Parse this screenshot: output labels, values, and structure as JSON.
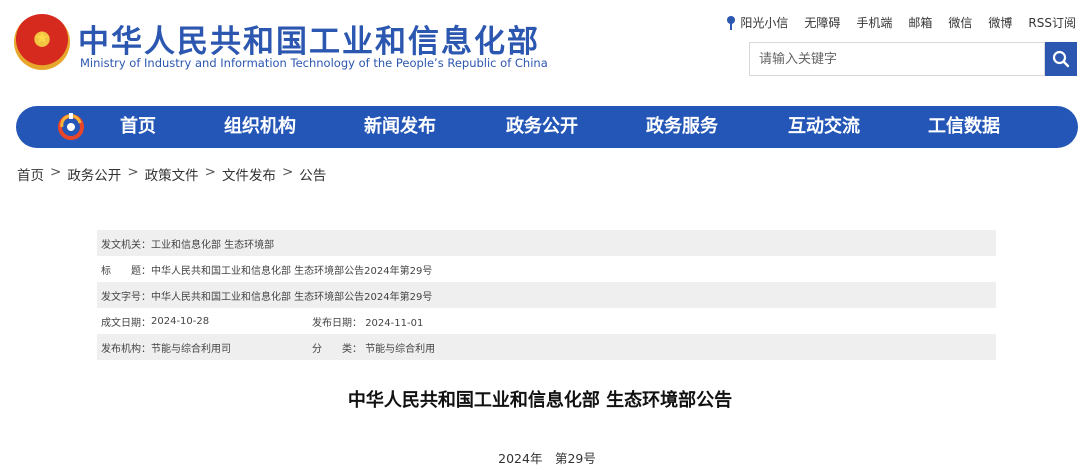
{
  "header": {
    "title": "中华人民共和国工业和信息化部",
    "subtitle": "Ministry of Industry and Information Technology of the People’s Republic of China",
    "emblem_icon": "national-emblem-icon",
    "toplinks": [
      "阳光小信",
      "无障碍",
      "手机端",
      "邮箱",
      "微信",
      "微博",
      "RSS订阅"
    ],
    "search_placeholder": "请输入关键字",
    "search_icon": "search-icon"
  },
  "colors": {
    "brand": "#2c57b0",
    "nav_bg": "#2356b6",
    "row_alt": "#efefef"
  },
  "nav": {
    "logo_icon": "miit-logo-icon",
    "items": [
      "首页",
      "组织机构",
      "新闻发布",
      "政务公开",
      "政务服务",
      "互动交流",
      "工信数据"
    ]
  },
  "breadcrumb": [
    "首页",
    "政务公开",
    "政策文件",
    "文件发布",
    "公告"
  ],
  "breadcrumb_sep": ">",
  "meta": {
    "issuer_label": "发文机关：",
    "issuer_value": "工业和信息化部 生态环境部",
    "title_label": "标　　题：",
    "title_value": "中华人民共和国工业和信息化部 生态环境部公告2024年第29号",
    "docno_label": "发文字号：",
    "docno_value": "中华人民共和国工业和信息化部 生态环境部公告2024年第29号",
    "created_label": "成文日期：",
    "created_value": "2024-10-28",
    "published_label": "发布日期：",
    "published_value": "2024-11-01",
    "org_label": "发布机构：",
    "org_value": "节能与综合利用司",
    "category_label": "分　　类：",
    "category_value": "节能与综合利用"
  },
  "document": {
    "title": "中华人民共和国工业和信息化部 生态环境部公告",
    "number": "2024年　第29号"
  }
}
